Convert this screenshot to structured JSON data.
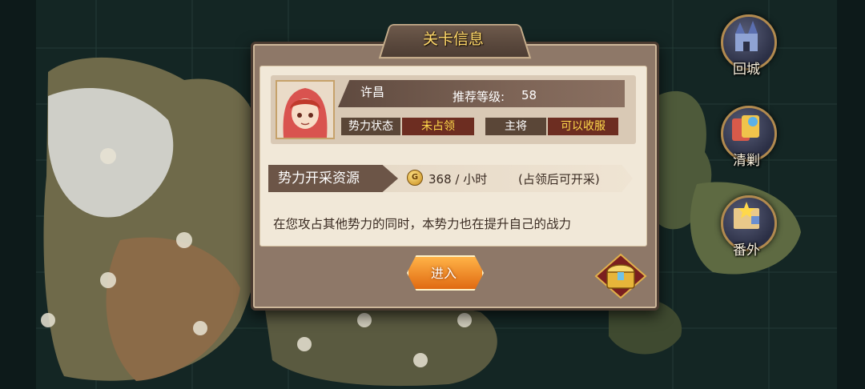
{
  "side_buttons": [
    {
      "label": "回城",
      "icon": "castle-icon"
    },
    {
      "label": "清剿",
      "icon": "scroll-cards-icon"
    },
    {
      "label": "番外",
      "icon": "map-scroll-icon"
    }
  ],
  "dialog": {
    "title": "关卡信息",
    "hero": {
      "name": "许昌",
      "recommended_level_label": "推荐等级:",
      "recommended_level_value": "58",
      "faction_status_label": "势力状态",
      "faction_status_value": "未占领",
      "general_label": "主将",
      "general_value": "可以收服"
    },
    "resource": {
      "label": "势力开采资源",
      "amount": "368 / 小时",
      "note": "(占领后可开采)",
      "icon": "coin-icon"
    },
    "description": "在您攻占其他势力的同时，本势力也在提升自己的战力",
    "enter_button": "进入",
    "reward_icon": "treasure-chest-icon"
  }
}
